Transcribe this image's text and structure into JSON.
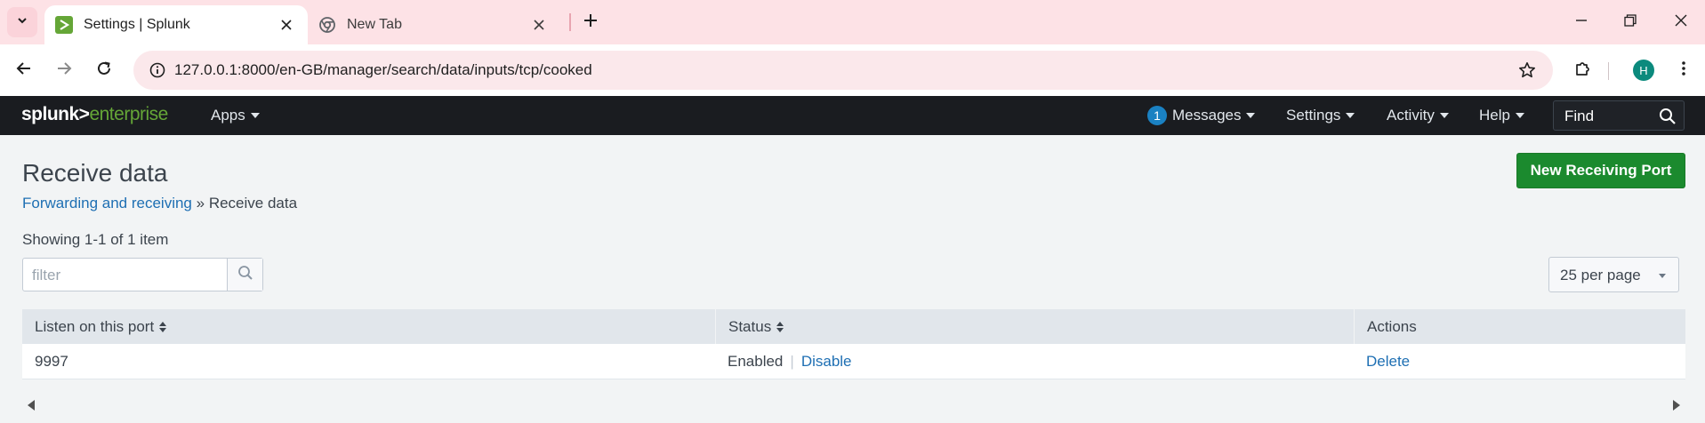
{
  "browser": {
    "tabs": [
      {
        "title": "Settings | Splunk",
        "active": true,
        "favicon": "splunk-favicon"
      },
      {
        "title": "New Tab",
        "active": false,
        "favicon": "chrome-favicon"
      }
    ],
    "url": "127.0.0.1:8000/en-GB/manager/search/data/inputs/tcp/cooked",
    "profile_initial": "H"
  },
  "splunk_nav": {
    "logo_left": "splunk>",
    "logo_right": "enterprise",
    "apps": "Apps",
    "messages_count": "1",
    "messages": "Messages",
    "settings": "Settings",
    "activity": "Activity",
    "help": "Help",
    "find_placeholder": "Find"
  },
  "page": {
    "title": "Receive data",
    "new_button": "New Receiving Port",
    "breadcrumb": {
      "link": "Forwarding and receiving",
      "separator": "»",
      "current": "Receive data"
    },
    "count": "Showing 1-1 of 1 item",
    "filter_placeholder": "filter",
    "per_page": "25 per page"
  },
  "table": {
    "columns": [
      "Listen on this port",
      "Status",
      "Actions"
    ],
    "rows": [
      {
        "port": "9997",
        "status": "Enabled",
        "toggle": "Disable",
        "action": "Delete"
      }
    ]
  },
  "colors": {
    "accent_green": "#1b8a2e",
    "link_blue": "#1e6fb3",
    "nav_bg": "#1a1c20",
    "tab_strip": "#fde2e6"
  }
}
